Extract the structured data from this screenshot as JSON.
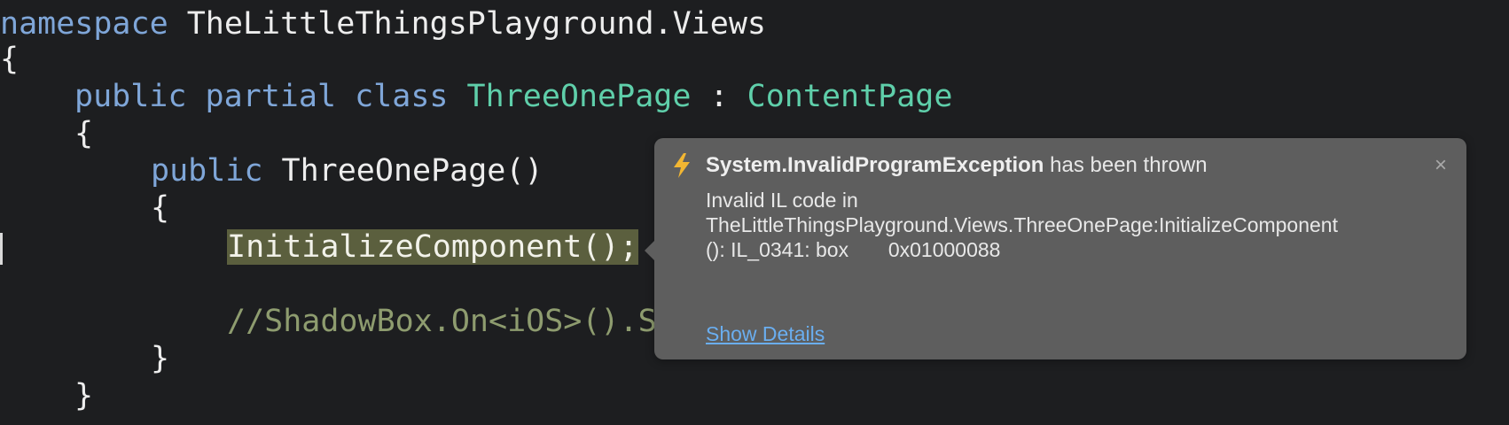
{
  "code": {
    "line1": {
      "keyword": "namespace",
      "name": "TheLittleThingsPlayground.Views"
    },
    "line2": {
      "text": "{"
    },
    "line3": {
      "kw1": "public",
      "kw2": "partial",
      "kw3": "class",
      "classname": "ThreeOnePage",
      "colon": ":",
      "basetype": "ContentPage"
    },
    "line4": {
      "text": "{"
    },
    "line5": {
      "keyword": "public",
      "ctor": "ThreeOnePage()"
    },
    "line6": {
      "text": "{"
    },
    "line7": {
      "text": "InitializeComponent();"
    },
    "line8": {
      "comment": "//ShadowBox.On<iOS>().S"
    },
    "line9": {
      "text": "}"
    },
    "line10": {
      "text": "}"
    }
  },
  "exception_popup": {
    "icon": "lightning-bolt-icon",
    "exception_type": "System.InvalidProgramException",
    "title_suffix": " has been thrown",
    "close_glyph": "×",
    "message": "Invalid IL code in\nTheLittleThingsPlayground.Views.ThreeOnePage:InitializeComponent\n(): IL_0341: box       0x01000088",
    "details_link": "Show Details"
  },
  "colors": {
    "editor_background": "#1d1e20",
    "keyword": "#7fa6d8",
    "type": "#5fcfaa",
    "comment": "#8e9c6f",
    "highlight": "#5b5f3e",
    "popup_background": "#5e5e5e",
    "link": "#6aaef0",
    "bolt": "#f2b632"
  }
}
